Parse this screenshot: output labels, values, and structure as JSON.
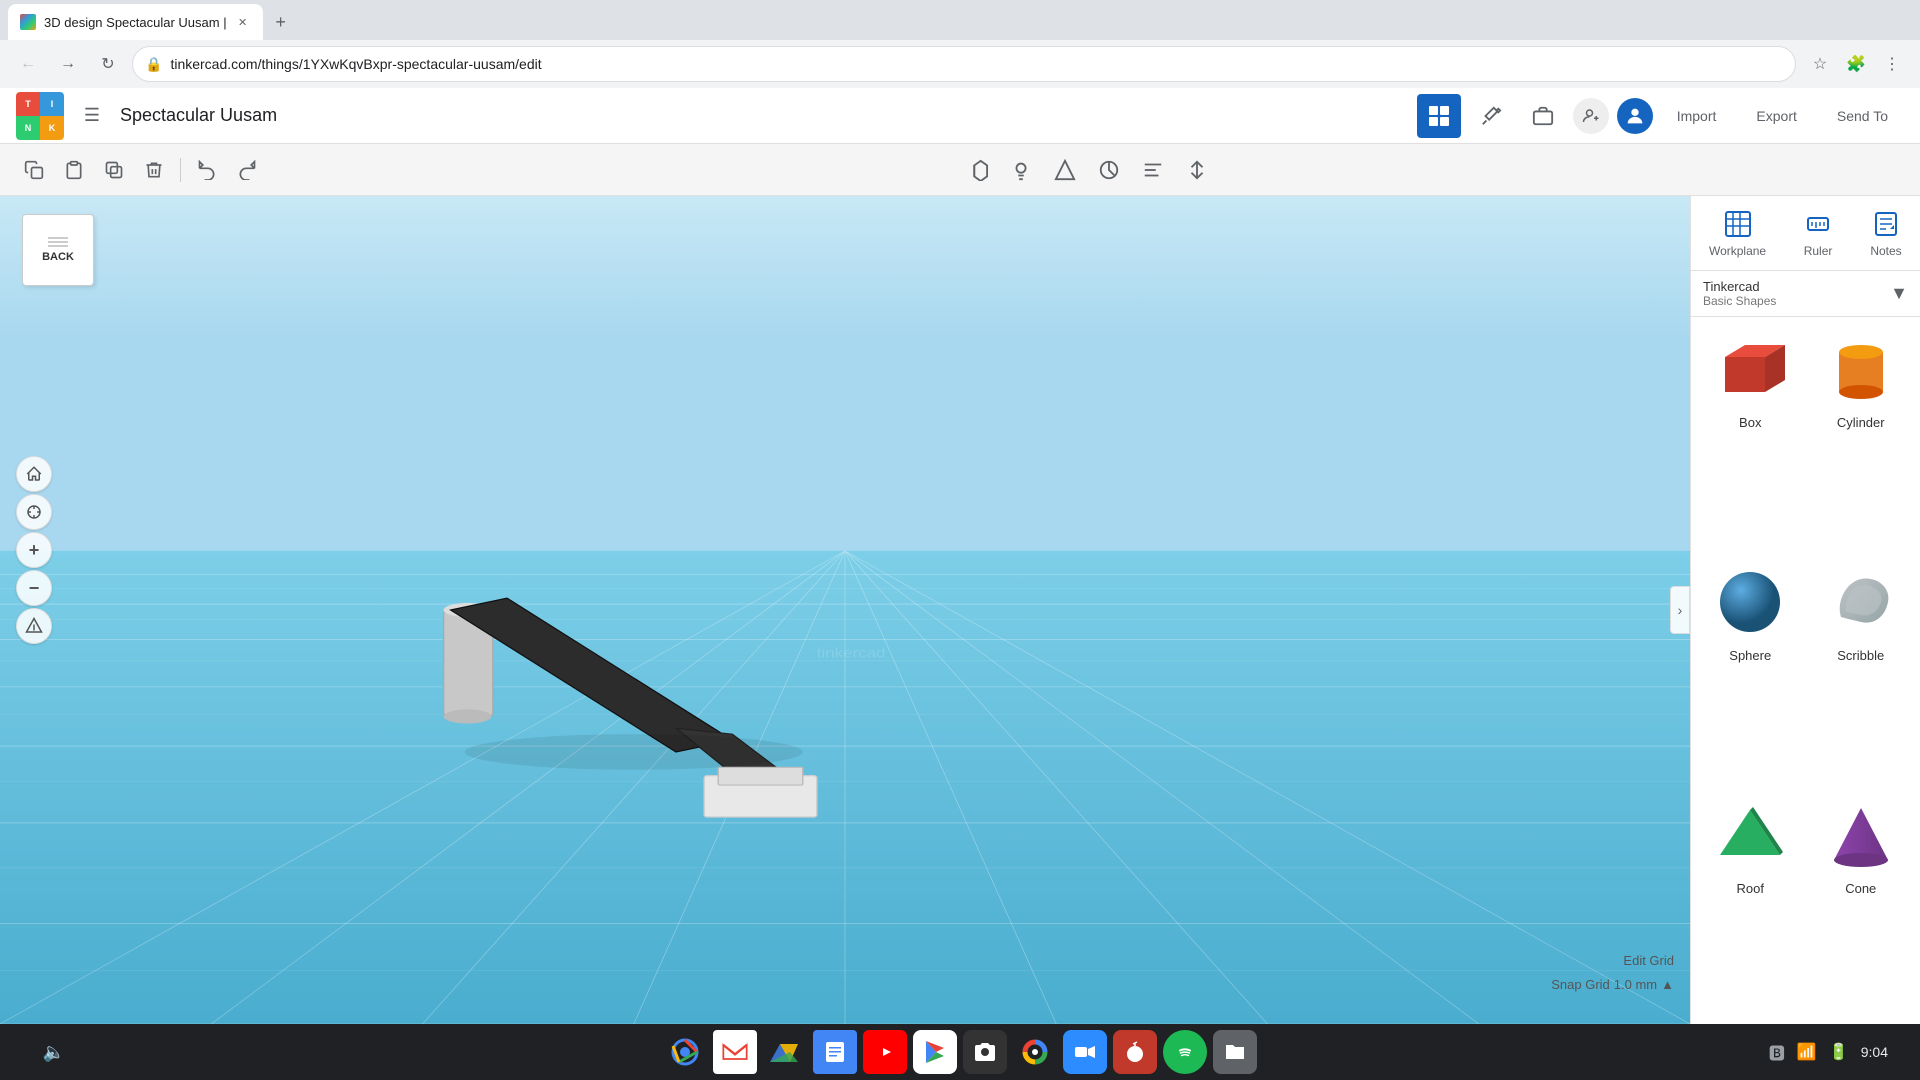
{
  "browser": {
    "tab": {
      "title": "3D design Spectacular Uusam |",
      "favicon": "tinkercad"
    },
    "url": "tinkercad.com/things/1YXwKqvBxpr-spectacular-uusam/edit"
  },
  "app": {
    "logo_letters": [
      "T",
      "I",
      "N",
      "K"
    ],
    "project_name": "Spectacular Uusam",
    "header_buttons": {
      "import": "Import",
      "export": "Export",
      "send_to": "Send To"
    }
  },
  "toolbar": {
    "tools": [
      "copy",
      "paste",
      "duplicate",
      "delete",
      "undo",
      "redo"
    ]
  },
  "right_panel": {
    "top_buttons": [
      {
        "label": "Workplane",
        "icon": "grid"
      },
      {
        "label": "Ruler",
        "icon": "ruler"
      },
      {
        "label": "Notes",
        "icon": "notes"
      }
    ],
    "shapes_category": "Tinkercad",
    "shapes_subcategory": "Basic Shapes",
    "shapes": [
      {
        "name": "Box",
        "color": "#e74c3c",
        "type": "box"
      },
      {
        "name": "Cylinder",
        "color": "#e67e22",
        "type": "cylinder"
      },
      {
        "name": "Sphere",
        "color": "#2980b9",
        "type": "sphere"
      },
      {
        "name": "Scribble",
        "color": "#95a5a6",
        "type": "scribble"
      },
      {
        "name": "Roof",
        "color": "#27ae60",
        "type": "roof"
      },
      {
        "name": "Cone",
        "color": "#8e44ad",
        "type": "cone"
      }
    ]
  },
  "viewport": {
    "edit_grid_label": "Edit Grid",
    "snap_grid_label": "Snap Grid",
    "snap_grid_value": "1.0 mm"
  },
  "back_card": {
    "label": "BACK"
  },
  "taskbar": {
    "time": "9:04",
    "icons": [
      "chrome",
      "gmail",
      "drive",
      "docs",
      "youtube",
      "play",
      "camera",
      "photos",
      "zoom",
      "pumpkin",
      "spotify",
      "files"
    ]
  }
}
